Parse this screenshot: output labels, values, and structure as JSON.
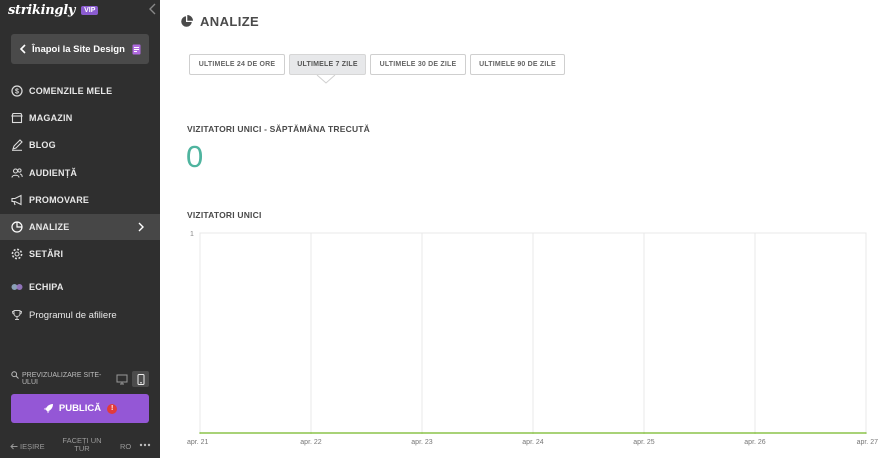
{
  "sidebar": {
    "brand": "strikingly",
    "badge": "VIP",
    "back_label": "Înapoi la Site Design",
    "items": [
      {
        "label": "COMENZILE MELE",
        "icon": "dollar-circle-icon"
      },
      {
        "label": "MAGAZIN",
        "icon": "store-icon"
      },
      {
        "label": "BLOG",
        "icon": "pen-icon"
      },
      {
        "label": "AUDIENȚĂ",
        "icon": "users-icon"
      },
      {
        "label": "PROMOVARE",
        "icon": "megaphone-icon"
      },
      {
        "label": "ANALIZE",
        "icon": "pie-chart-icon",
        "active": true
      },
      {
        "label": "SETĂRI",
        "icon": "gear-icon"
      },
      {
        "label": "ECHIPA",
        "icon": "team-icon"
      },
      {
        "label": "Programul de afiliere",
        "icon": "trophy-icon"
      }
    ],
    "preview_label": "PREVIZUALIZARE SITE-ULUI",
    "publish_label": "PUBLICĂ",
    "alert": "!",
    "footer": {
      "exit_label": "IEȘIRE",
      "tour_label": "FACEȚI UN TUR",
      "language": "RO"
    }
  },
  "main": {
    "title": "ANALIZE",
    "range_tabs": [
      {
        "label": "ULTIMELE 24 DE ORE",
        "selected": false
      },
      {
        "label": "ULTIMELE 7 ZILE",
        "selected": true
      },
      {
        "label": "ULTIMELE 30 DE ZILE",
        "selected": false
      },
      {
        "label": "ULTIMELE 90 DE ZILE",
        "selected": false
      }
    ],
    "unique_week_label": "VIZITATORI UNICI - SĂPTĂMÂNA TRECUTĂ",
    "unique_week_value": "0",
    "unique_chart_title": "VIZITATORI UNICI"
  },
  "colors": {
    "sidebar_bg": "#2f2f2f",
    "accent_purple": "#9457d6",
    "value_green": "#4fb49f",
    "line_green": "#8bc34a"
  },
  "chart_data": {
    "type": "line",
    "title": "VIZITATORI UNICI",
    "x": [
      "apr. 21",
      "apr. 22",
      "apr. 23",
      "apr. 24",
      "apr. 25",
      "apr. 26",
      "apr. 27"
    ],
    "series": [
      {
        "values": [
          0,
          0,
          0,
          0,
          0,
          0,
          0
        ]
      }
    ],
    "ylim": [
      0,
      1
    ],
    "yticks": [
      "1"
    ],
    "grid": true
  }
}
